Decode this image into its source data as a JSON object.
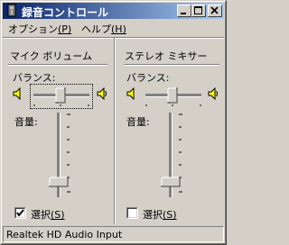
{
  "window": {
    "title": "録音コントロール",
    "controls": [
      "minimize",
      "maximize",
      "close"
    ]
  },
  "menu": {
    "options_label": "オプション",
    "options_key": "(P)",
    "help_label": "ヘルプ",
    "help_key": "(H)"
  },
  "channels": [
    {
      "title": "マイク ボリューム",
      "balance_label": "バランス:",
      "volume_label": "音量:",
      "balance_value": 0.5,
      "volume_level": 0.2,
      "select_label": "選択",
      "select_key": "(S)",
      "selected": true,
      "icon_left": "speaker-left-icon",
      "icon_right": "speaker-right-icon"
    },
    {
      "title": "ステレオ ミキサー",
      "balance_label": "バランス:",
      "volume_label": "音量:",
      "balance_value": 0.5,
      "volume_level": 0.2,
      "select_label": "選択",
      "select_key": "(S)",
      "selected": false,
      "icon_left": "speaker-left-icon",
      "icon_right": "speaker-right-icon"
    }
  ],
  "status": {
    "text": "Realtek HD Audio Input"
  },
  "colors": {
    "face": "#d4d0c8",
    "title_start": "#0a246a",
    "title_end": "#a6caf0",
    "speaker_yellow": "#ffff00"
  }
}
